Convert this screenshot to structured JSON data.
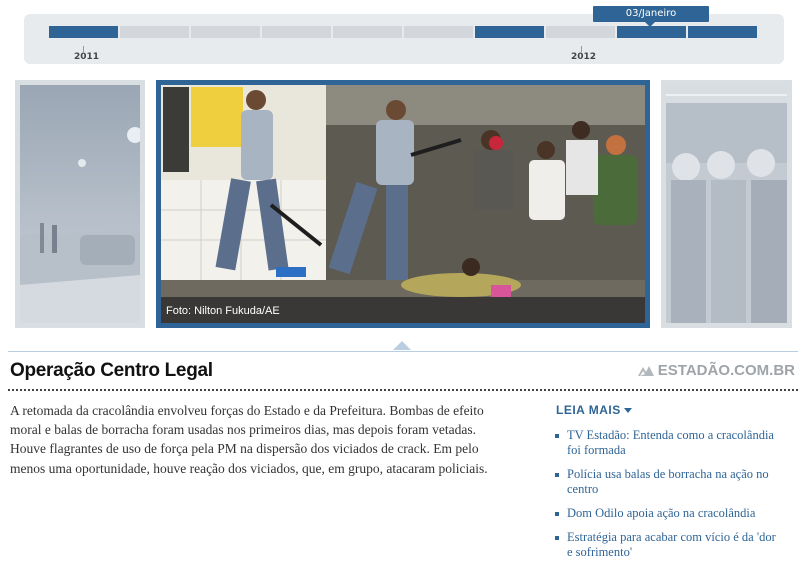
{
  "timeline": {
    "segments": [
      true,
      false,
      false,
      false,
      false,
      false,
      true,
      false,
      true,
      true
    ],
    "year_left": "2011",
    "year_right": "2012",
    "bubble": "03/Janeiro"
  },
  "gallery": {
    "caption": "Foto: Nilton Fukuda/AE"
  },
  "article": {
    "title": "Operação Centro Legal",
    "brand": "ESTADÃO.COM.BR",
    "body": "A retomada da cracolândia envolveu forças do Estado e da Prefeitura. Bombas de efeito moral e balas de borracha foram usadas nos primeiros dias, mas depois foram vetadas. Houve flagrantes de uso de força pela PM na dispersão dos viciados de crack. Em pelo menos uma oportunidade, houve reação dos viciados, que, em grupo, atacaram policiais."
  },
  "sidebar": {
    "heading": "LEIA MAIS",
    "links": [
      "TV Estadão: Entenda como a cracolândia foi formada",
      "Polícia usa balas de borracha na ação no centro",
      "Dom Odilo apoia ação na cracolândia",
      "Estratégia para acabar com vício é da 'dor e sofrimento'"
    ]
  },
  "colors": {
    "accent": "#2f6596",
    "inactive_segment": "#d3d7db"
  }
}
